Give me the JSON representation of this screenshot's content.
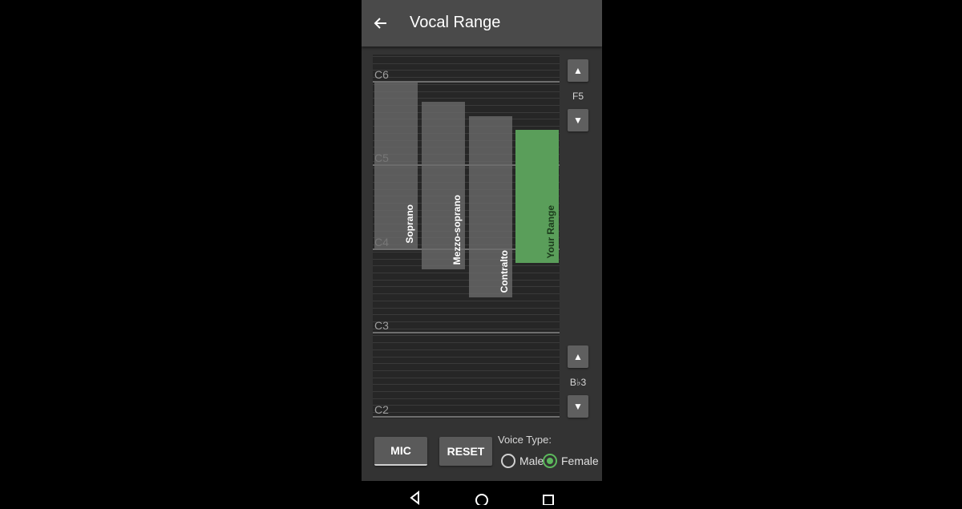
{
  "app": {
    "title": "Vocal Range",
    "back_icon": "arrow-left-icon"
  },
  "staff": {
    "c_labels": [
      "C6",
      "C5",
      "C4",
      "C3",
      "C2"
    ]
  },
  "ranges": [
    {
      "name": "Soprano",
      "low": "C4",
      "high": "C6",
      "color": "#6c6c6c"
    },
    {
      "name": "Mezzo-soprano",
      "low": "A3",
      "high": "A5",
      "color": "#6c6c6c"
    },
    {
      "name": "Contralto",
      "low": "F3",
      "high": "F5",
      "color": "#6c6c6c"
    },
    {
      "name": "Your Range",
      "low": "B♭3",
      "high": "F5",
      "color": "#5a9e5a"
    }
  ],
  "controls": {
    "high_note": {
      "label": "F5",
      "up_icon": "▲",
      "down_icon": "▼"
    },
    "low_note": {
      "label": "B♭3",
      "up_icon": "▲",
      "down_icon": "▼"
    }
  },
  "actions": {
    "mic_label": "MIC",
    "reset_label": "RESET"
  },
  "voice_type": {
    "label": "Voice Type:",
    "options": [
      {
        "label": "Male",
        "selected": false
      },
      {
        "label": "Female",
        "selected": true
      }
    ],
    "accent_color": "#5cb85c"
  },
  "navbar": {
    "back_icon": "triangle-back-icon",
    "home_icon": "circle-home-icon",
    "recents_icon": "square-recents-icon"
  }
}
